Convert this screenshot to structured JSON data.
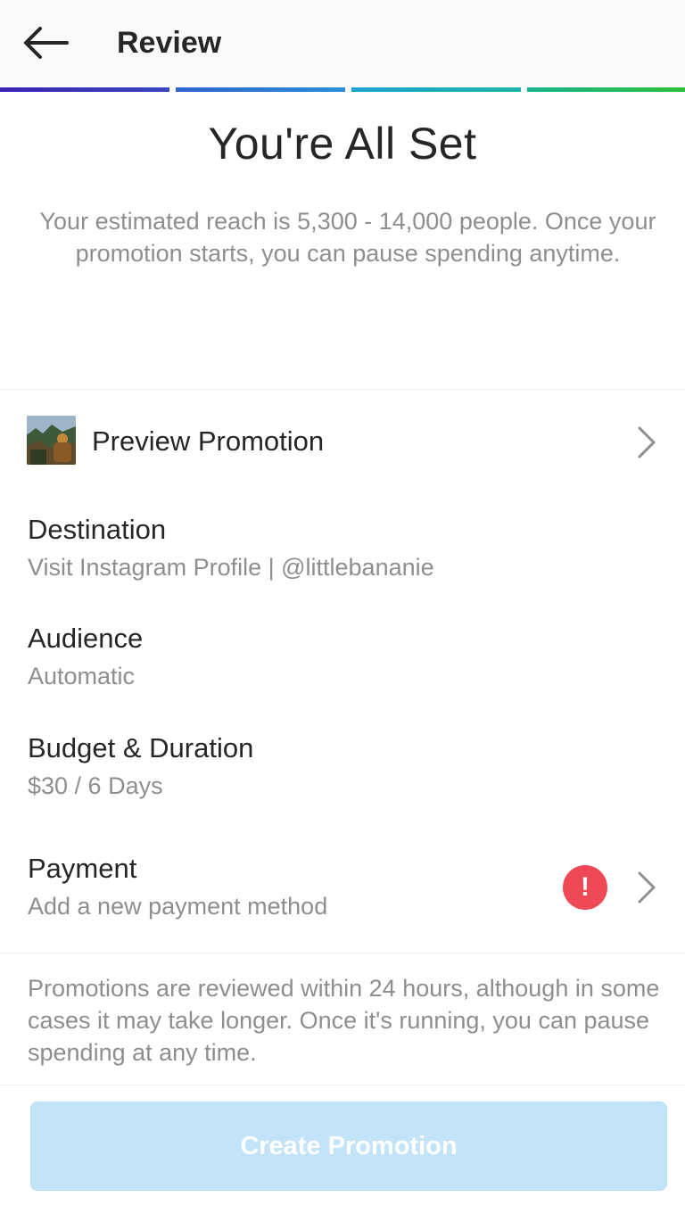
{
  "header": {
    "title": "Review",
    "back_icon": "arrow-left-icon"
  },
  "progress": {
    "steps": 4,
    "completed": 4,
    "colors": [
      "#3a2fb8",
      "#1a6fd6",
      "#1aa3c8",
      "#2bb84a"
    ]
  },
  "hero": {
    "title": "You're All Set",
    "description": "Your estimated reach is 5,300 - 14,000 people. Once your promotion starts, you can pause spending anytime."
  },
  "preview": {
    "label": "Preview Promotion",
    "thumbnail_icon": "post-thumbnail",
    "chevron_icon": "chevron-right-icon"
  },
  "details": {
    "destination": {
      "title": "Destination",
      "value": "Visit Instagram Profile | @littlebananie"
    },
    "audience": {
      "title": "Audience",
      "value": "Automatic"
    },
    "budget": {
      "title": "Budget & Duration",
      "value": "$30 / 6 Days"
    },
    "payment": {
      "title": "Payment",
      "value": "Add a new payment method",
      "alert_symbol": "!",
      "alert_color": "#ed4956"
    }
  },
  "footer_note": "Promotions are reviewed within 24 hours, although in some cases it may take longer. Once it's running, you can pause spending at any time.",
  "create_button": {
    "label": "Create Promotion",
    "enabled": false,
    "color": "#c3e3f9"
  }
}
